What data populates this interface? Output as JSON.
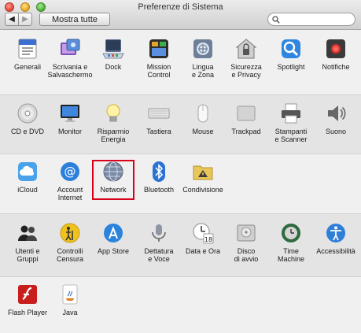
{
  "window": {
    "title": "Preferenze di Sistema"
  },
  "toolbar": {
    "back_label": "◀",
    "forward_label": "▶",
    "show_all_label": "Mostra tutte",
    "search_placeholder": ""
  },
  "sections": [
    [
      {
        "id": "generali",
        "label": "Generali",
        "icon": "general-icon"
      },
      {
        "id": "scrivania",
        "label": "Scrivania e\nSalvaschermo",
        "icon": "desktop-screensaver-icon"
      },
      {
        "id": "dock",
        "label": "Dock",
        "icon": "dock-icon"
      },
      {
        "id": "mission",
        "label": "Mission\nControl",
        "icon": "mission-control-icon"
      },
      {
        "id": "lingua",
        "label": "Lingua\ne Zona",
        "icon": "flag-icon"
      },
      {
        "id": "sicurezza",
        "label": "Sicurezza\ne Privacy",
        "icon": "house-lock-icon"
      },
      {
        "id": "spotlight",
        "label": "Spotlight",
        "icon": "spotlight-icon"
      },
      {
        "id": "notifiche",
        "label": "Notifiche",
        "icon": "notifications-icon"
      }
    ],
    [
      {
        "id": "cd-dvd",
        "label": "CD e DVD",
        "icon": "disc-icon"
      },
      {
        "id": "monitor",
        "label": "Monitor",
        "icon": "monitor-icon"
      },
      {
        "id": "risparmio",
        "label": "Risparmio\nEnergia",
        "icon": "lightbulb-icon"
      },
      {
        "id": "tastiera",
        "label": "Tastiera",
        "icon": "keyboard-icon"
      },
      {
        "id": "mouse",
        "label": "Mouse",
        "icon": "mouse-icon"
      },
      {
        "id": "trackpad",
        "label": "Trackpad",
        "icon": "trackpad-icon"
      },
      {
        "id": "stampanti",
        "label": "Stampanti\ne Scanner",
        "icon": "printer-icon"
      },
      {
        "id": "suono",
        "label": "Suono",
        "icon": "speaker-icon"
      }
    ],
    [
      {
        "id": "icloud",
        "label": "iCloud",
        "icon": "cloud-icon"
      },
      {
        "id": "account-internet",
        "label": "Account\nInternet",
        "icon": "at-sign-icon"
      },
      {
        "id": "network",
        "label": "Network",
        "icon": "network-globe-icon"
      },
      {
        "id": "bluetooth",
        "label": "Bluetooth",
        "icon": "bluetooth-icon"
      },
      {
        "id": "condivisione",
        "label": "Condivisione",
        "icon": "sharing-folder-icon"
      }
    ],
    [
      {
        "id": "utenti",
        "label": "Utenti e\nGruppi",
        "icon": "users-icon"
      },
      {
        "id": "controlli",
        "label": "Controlli\nCensura",
        "icon": "parental-controls-icon"
      },
      {
        "id": "appstore",
        "label": "App Store",
        "icon": "app-store-icon"
      },
      {
        "id": "dettatura",
        "label": "Dettatura\ne Voce",
        "icon": "microphone-icon"
      },
      {
        "id": "data-ora",
        "label": "Data e Ora",
        "icon": "clock-calendar-icon"
      },
      {
        "id": "disco",
        "label": "Disco\ndi avvio",
        "icon": "hard-drive-icon"
      },
      {
        "id": "time-machine",
        "label": "Time\nMachine",
        "icon": "time-machine-icon"
      },
      {
        "id": "accessibilita",
        "label": "Accessibilità",
        "icon": "accessibility-icon"
      }
    ],
    [
      {
        "id": "flash",
        "label": "Flash Player",
        "icon": "flash-icon"
      },
      {
        "id": "java",
        "label": "Java",
        "icon": "java-icon"
      }
    ]
  ],
  "highlighted_pane": "network",
  "colors": {
    "highlight": "#d9001b",
    "accent": "#2c7fe0"
  }
}
